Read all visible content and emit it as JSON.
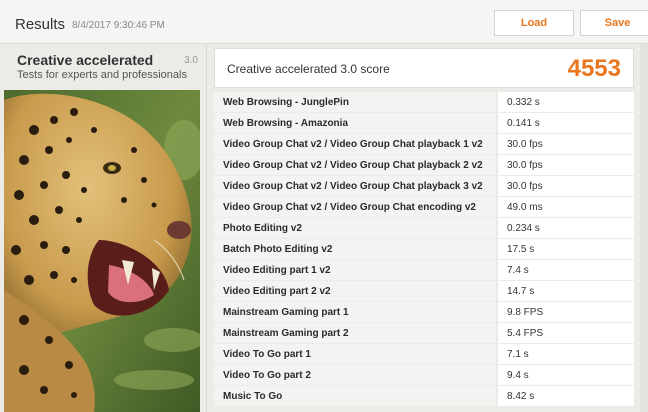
{
  "header": {
    "title": "Results",
    "timestamp": "8/4/2017 9:30:46 PM",
    "load_label": "Load",
    "save_label": "Save"
  },
  "test": {
    "name": "Creative accelerated",
    "version": "3.0",
    "description": "Tests for experts and professionals"
  },
  "score": {
    "label": "Creative accelerated 3.0 score",
    "value": "4553"
  },
  "results": [
    {
      "name": "Web Browsing - JunglePin",
      "value": "0.332 s"
    },
    {
      "name": "Web Browsing - Amazonia",
      "value": "0.141 s"
    },
    {
      "name": "Video Group Chat v2 / Video Group Chat playback 1 v2",
      "value": "30.0 fps"
    },
    {
      "name": "Video Group Chat v2 / Video Group Chat playback 2 v2",
      "value": "30.0 fps"
    },
    {
      "name": "Video Group Chat v2 / Video Group Chat playback 3 v2",
      "value": "30.0 fps"
    },
    {
      "name": "Video Group Chat v2 / Video Group Chat encoding v2",
      "value": "49.0 ms"
    },
    {
      "name": "Photo Editing v2",
      "value": "0.234 s"
    },
    {
      "name": "Batch Photo Editing v2",
      "value": "17.5 s"
    },
    {
      "name": "Video Editing part 1 v2",
      "value": "7.4 s"
    },
    {
      "name": "Video Editing part 2 v2",
      "value": "14.7 s"
    },
    {
      "name": "Mainstream Gaming part 1",
      "value": "9.8 FPS"
    },
    {
      "name": "Mainstream Gaming part 2",
      "value": "5.4 FPS"
    },
    {
      "name": "Video To Go part 1",
      "value": "7.1 s"
    },
    {
      "name": "Video To Go part 2",
      "value": "9.4 s"
    },
    {
      "name": "Music To Go",
      "value": "8.42 s"
    }
  ],
  "colors": {
    "accent": "#e8771f",
    "background": "#ecebe8"
  },
  "icons": {
    "test_image": "leopard-photo"
  }
}
